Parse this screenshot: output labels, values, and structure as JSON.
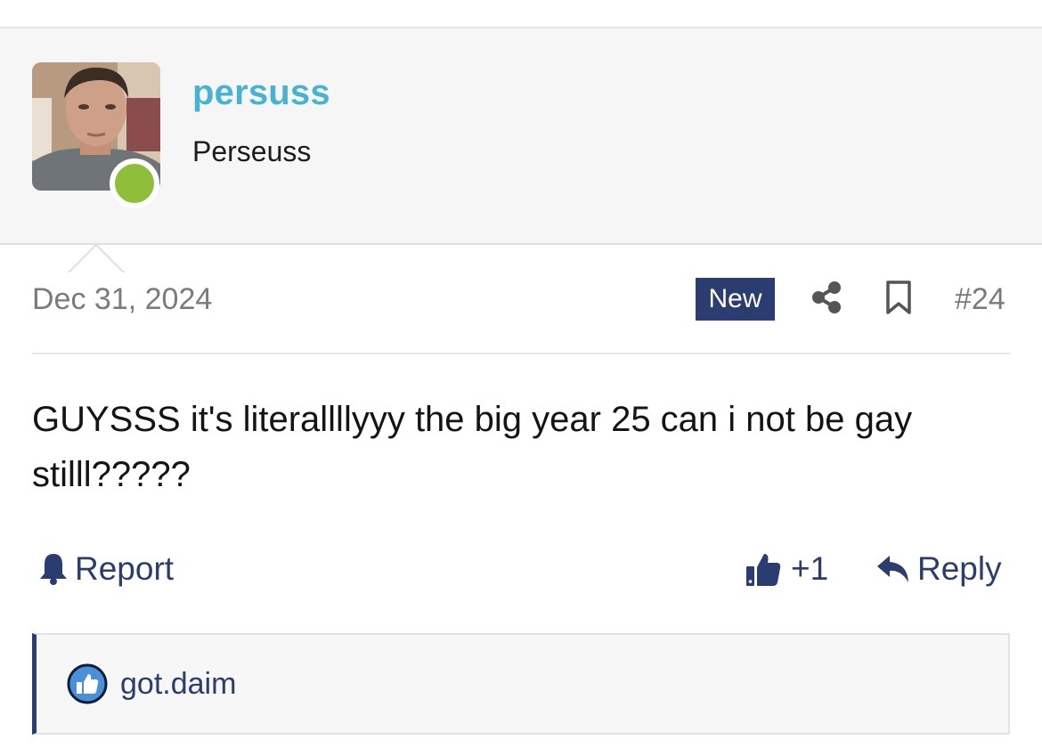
{
  "user": {
    "username": "persuss",
    "title": "Perseuss",
    "online": true
  },
  "post": {
    "date": "Dec 31, 2024",
    "badge": "New",
    "number": "#24",
    "body": "GUYSSS it's literallllyyy the big year 25 can i not be gay stilll?????"
  },
  "actions": {
    "report_label": "Report",
    "like_label": "+1",
    "reply_label": "Reply"
  },
  "reactions": {
    "users": "got.daim"
  },
  "icons": {
    "report": "bell-icon",
    "like": "thumbs-up-icon",
    "reply": "reply-arrow-icon",
    "share": "share-icon",
    "bookmark": "bookmark-icon",
    "reaction": "like-reaction-icon"
  },
  "colors": {
    "username": "#47b3d2",
    "accent": "#2a3c70",
    "online": "#8fbf3a",
    "muted": "#7b7b7b"
  }
}
